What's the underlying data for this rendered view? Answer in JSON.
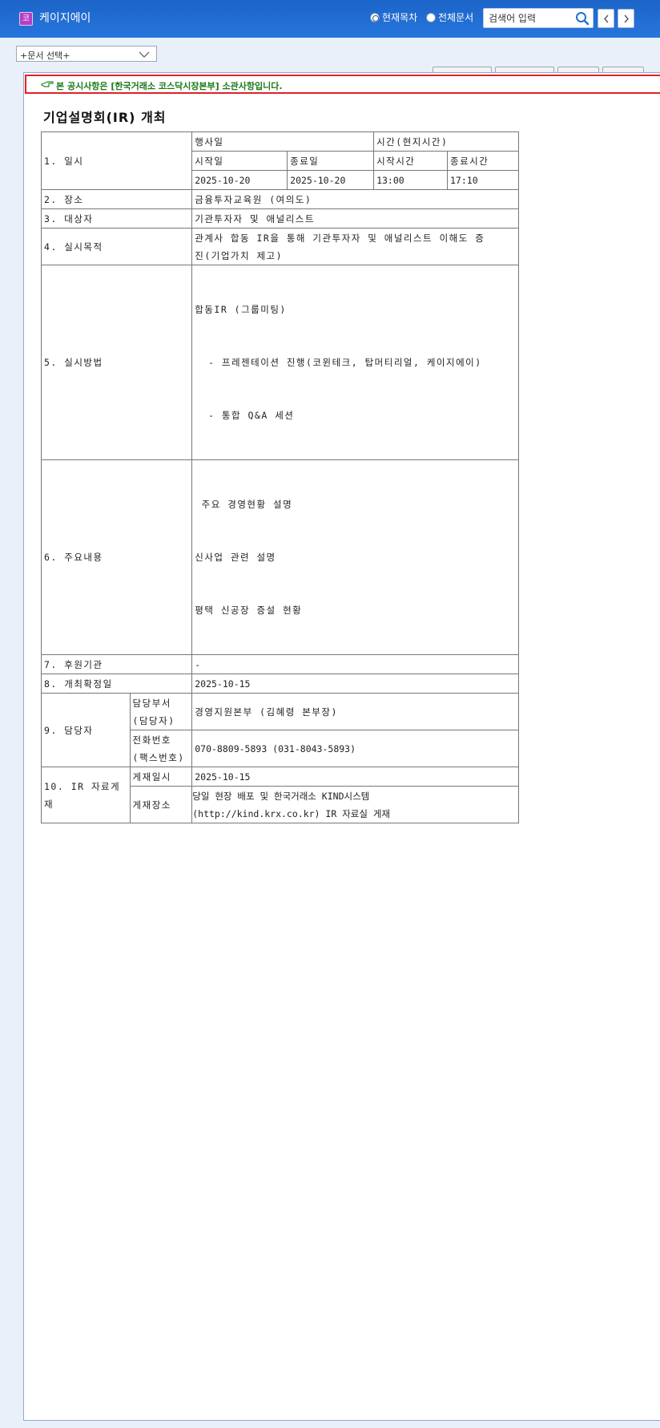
{
  "header": {
    "company_icon_char": "코",
    "company_name": "케이지에이",
    "radio_current": "현재목차",
    "radio_all": "전체문서",
    "search_placeholder": "검색어 입력"
  },
  "doc_select": {
    "value": "+문서 선택+"
  },
  "notice": {
    "text": "본 공시사항은 [한국거래소 코스닥시장본부] 소관사항입니다."
  },
  "document": {
    "title": "기업설명회(IR) 개최",
    "rows": {
      "r1_label": "1. 일시",
      "event_date": "행사일",
      "local_time": "시간(현지시간)",
      "start_date_label": "시작일",
      "end_date_label": "종료일",
      "start_time_label": "시작시간",
      "end_time_label": "종료시간",
      "start_date": "2025-10-20",
      "end_date": "2025-10-20",
      "start_time": "13:00",
      "end_time": "17:10",
      "r2_label": "2. 장소",
      "r2_value": "금융투자교육원 (여의도)",
      "r3_label": "3. 대상자",
      "r3_value": "기관투자자 및 애널리스트",
      "r4_label": "4. 실시목적",
      "r4_value_1": "관계사 합동 IR을 통해 기관투자자 및 애널리스트 이해도 증",
      "r4_value_2": "진(기업가치 제고)",
      "r5_label": "5. 실시방법",
      "r5_value_1": "합동IR (그룹미팅)",
      "r5_value_2": "  - 프레젠테이션 진행(코윈테크, 탑머티리얼, 케이지에이)",
      "r5_value_3": "  - 통합 Q&A 세션",
      "r6_label": "6. 주요내용",
      "r6_value_1": " 주요 경영현황 설명",
      "r6_value_2": "신사업 관련 설명",
      "r6_value_3": "평택 신공장 증설 현황",
      "r7_label": "7. 후원기관",
      "r7_value": "-",
      "r8_label": "8. 개최확정일",
      "r8_value": "2025-10-15",
      "r9_label": "9. 담당자",
      "r9_dept_1": "담당부서",
      "r9_dept_2": "(담당자)",
      "r9_dept_value": "경영지원본부 (김혜령 본부장)",
      "r9_phone_1": "전화번호",
      "r9_phone_2": "(팩스번호)",
      "r9_phone_value": "070-8809-5893 (031-8043-5893)",
      "r10_label": "10. IR 자료게재",
      "r10_date_label": "게재일시",
      "r10_date_value": "2025-10-15",
      "r10_place_label": "게재장소",
      "r10_place_value_1": "당일 현장 배포 및 한국거래소 KIND시스템",
      "r10_place_value_2": "(http://kind.krx.co.kr) IR 자료실 게재"
    }
  }
}
